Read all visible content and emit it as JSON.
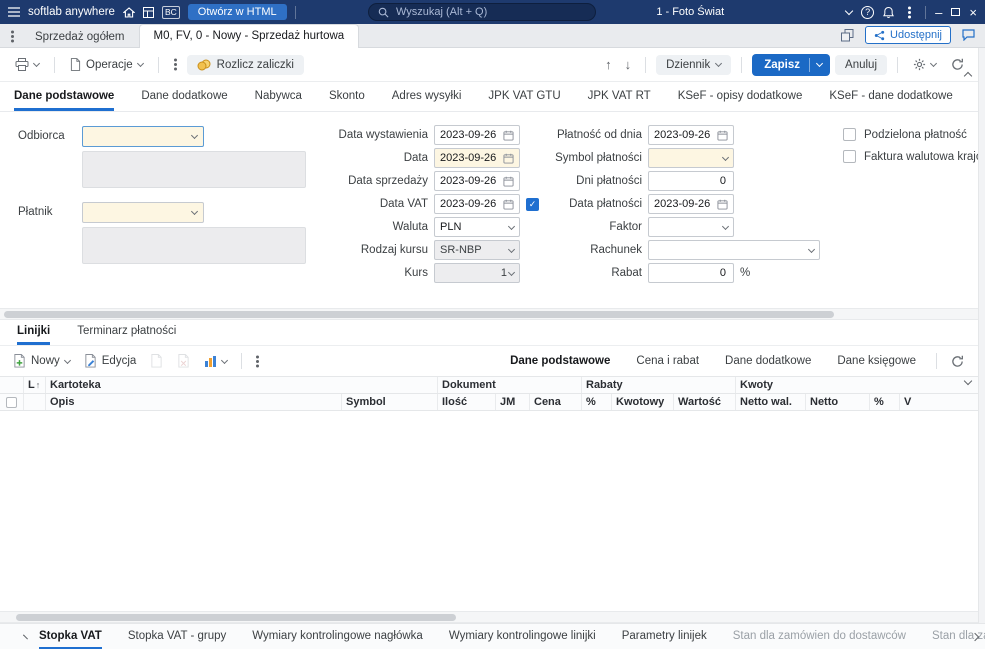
{
  "topbar": {
    "app_name": "softlab anywhere",
    "bc_badge": "BC",
    "open_html": "Otwórz w HTML",
    "search_placeholder": "Wyszukaj (Alt + Q)",
    "company": "1 - Foto Świat"
  },
  "doc_tabs": {
    "tab1": "Sprzedaż ogółem",
    "tab2": "M0, FV, 0 - Nowy - Sprzedaż hurtowa",
    "share": "Udostępnij"
  },
  "toolbar": {
    "operacje": "Operacje",
    "rozlicz": "Rozlicz zaliczki",
    "dziennik": "Dziennik",
    "zapisz": "Zapisz",
    "anuluj": "Anuluj"
  },
  "form_tabs": [
    "Dane podstawowe",
    "Dane dodatkowe",
    "Nabywca",
    "Skonto",
    "Adres wysyłki",
    "JPK VAT GTU",
    "JPK VAT RT",
    "KSeF - opisy dodatkowe",
    "KSeF - dane dodatkowe"
  ],
  "form": {
    "odbiorca": "Odbiorca",
    "platnik": "Płatnik",
    "col1": [
      {
        "label": "Data wystawienia",
        "value": "2023-09-26"
      },
      {
        "label": "Data",
        "value": "2023-09-26"
      },
      {
        "label": "Data sprzedaży",
        "value": "2023-09-26"
      },
      {
        "label": "Data VAT",
        "value": "2023-09-26"
      },
      {
        "label": "Waluta",
        "value": "PLN"
      },
      {
        "label": "Rodzaj kursu",
        "value": "SR-NBP"
      },
      {
        "label": "Kurs",
        "value": "1"
      }
    ],
    "col2": [
      {
        "label": "Płatność od dnia",
        "value": "2023-09-26"
      },
      {
        "label": "Symbol płatności",
        "value": ""
      },
      {
        "label": "Dni płatności",
        "value": "0"
      },
      {
        "label": "Data płatności",
        "value": "2023-09-26"
      },
      {
        "label": "Faktor",
        "value": ""
      },
      {
        "label": "Rachunek",
        "value": ""
      },
      {
        "label": "Rabat",
        "value": "0",
        "suffix": "%"
      }
    ],
    "checkboxes": [
      "Podzielona płatność",
      "Faktura walutowa krajo"
    ]
  },
  "section_tabs": [
    "Linijki",
    "Terminarz płatności"
  ],
  "grid_toolbar": {
    "nowy": "Nowy",
    "edycja": "Edycja",
    "right_tabs": [
      "Dane podstawowe",
      "Cena i rabat",
      "Dane dodatkowe",
      "Dane księgowe"
    ]
  },
  "grid": {
    "groups": {
      "l": "L",
      "kartoteka": "Kartoteka",
      "dokument": "Dokument",
      "rabaty": "Rabaty",
      "kwoty": "Kwoty"
    },
    "cols": [
      "Opis",
      "Symbol",
      "Ilość",
      "JM",
      "Cena",
      "%",
      "Kwotowy",
      "Wartość",
      "Netto wal.",
      "Netto",
      "%",
      "V"
    ]
  },
  "bottom_tabs": [
    "Stopka VAT",
    "Stopka VAT - grupy",
    "Wymiary kontrolingowe nagłówka",
    "Wymiary kontrolingowe linijki",
    "Parametry linijek",
    "Stan dla zamówien do dostawców",
    "Stan dla zamówie"
  ],
  "icons": {
    "up_arrow": "↑",
    "down_arrow": "↓",
    "sort_asc": "↑",
    "minimize": "–",
    "close": "×",
    "help": "?",
    "check": "✓"
  },
  "colors": {
    "topbar": "#1e3a6e",
    "accent": "#1f6fd0",
    "save_button": "#1b69c5",
    "field_highlight": "#fdf6e2"
  }
}
